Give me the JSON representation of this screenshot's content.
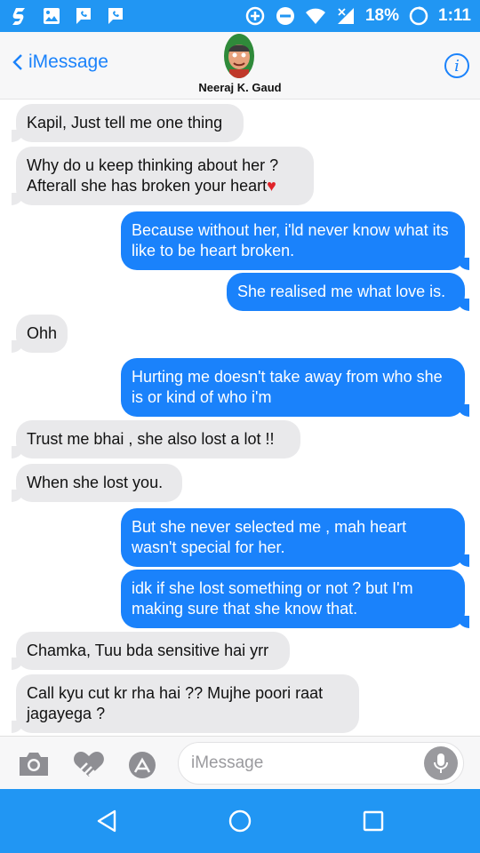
{
  "status_bar": {
    "battery": "18%",
    "time": "1:11",
    "icons": [
      "s-app-icon",
      "gallery-icon",
      "voice-chat-icon",
      "voice-chat-icon",
      "data-saver-icon",
      "do-not-disturb-icon",
      "wifi-icon",
      "signal-icon",
      "battery-icon"
    ]
  },
  "header": {
    "back_label": "iMessage",
    "contact_name": "Neeraj K. Gaud",
    "info_label": "i"
  },
  "messages": [
    {
      "side": "in",
      "text": "Kapil, Just tell me one thing"
    },
    {
      "side": "in",
      "text": "Why do u keep thinking about her ? Afterall she has broken your heart",
      "emoji": "♥"
    },
    {
      "side": "out",
      "text": "Because without her, i'ld never know what its like to be heart broken."
    },
    {
      "side": "out",
      "text": "She realised me what love is."
    },
    {
      "side": "in",
      "text": "Ohh"
    },
    {
      "side": "out",
      "text": "Hurting me doesn't take away from who she is or kind of who i'm"
    },
    {
      "side": "in",
      "text": "Trust me bhai ,  she also lost a lot !!"
    },
    {
      "side": "in",
      "text": "When she lost you."
    },
    {
      "side": "out",
      "text": "But she never selected me , mah heart wasn't special for her."
    },
    {
      "side": "out",
      "text": "idk if she lost something or not ? but I'm making sure that she know that."
    },
    {
      "side": "in",
      "text": "Chamka, Tuu bda sensitive hai yrr"
    },
    {
      "side": "in",
      "text": "Call kyu cut kr rha hai ?? Mujhe poori raat jagayega ?"
    }
  ],
  "input": {
    "placeholder": "iMessage"
  },
  "colors": {
    "accent": "#2196F3",
    "outgoing_bubble": "#1a82fb",
    "incoming_bubble": "#e9e9eb"
  }
}
